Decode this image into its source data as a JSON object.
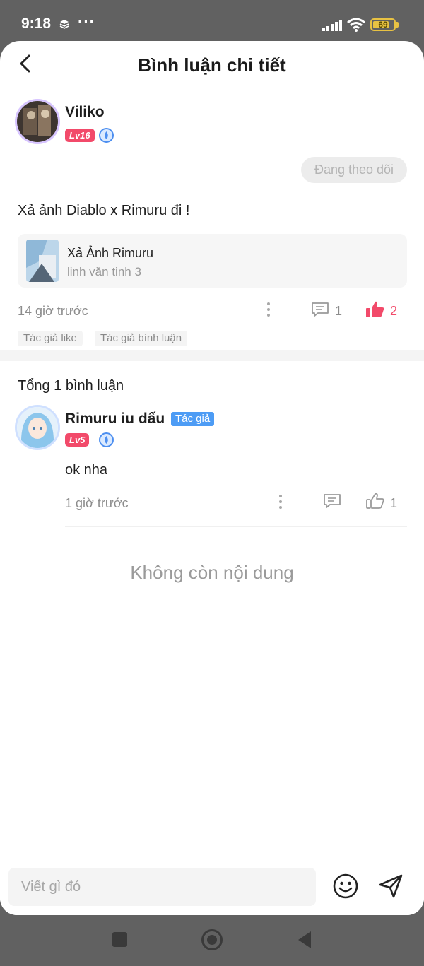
{
  "status_bar": {
    "time": "9:18",
    "battery": "69"
  },
  "header": {
    "title": "Bình luận chi tiết"
  },
  "main_comment": {
    "user": "Viliko",
    "level": "Lv16",
    "follow_label": "Đang theo dõi",
    "text": "Xả ảnh Diablo x Rimuru đi !",
    "quote": {
      "title": "Xả Ảnh Rimuru",
      "subtitle": "linh văn tinh 3"
    },
    "time": "14 giờ trước",
    "reply_count": "1",
    "like_count": "2",
    "tags": [
      "Tác giả like",
      "Tác giả bình luận"
    ]
  },
  "replies_section": {
    "total": "Tổng 1 bình luận",
    "reply": {
      "user": "Rimuru iu dấu",
      "author_tag": "Tác giả",
      "level": "Lv5",
      "text": "ok nha",
      "time": "1 giờ trước",
      "like_count": "1"
    },
    "end_text": "Không còn nội dung"
  },
  "input": {
    "placeholder": "Viết gì đó"
  },
  "colors": {
    "accent_red": "#f24a6a",
    "author_blue": "#4d9cf5"
  }
}
